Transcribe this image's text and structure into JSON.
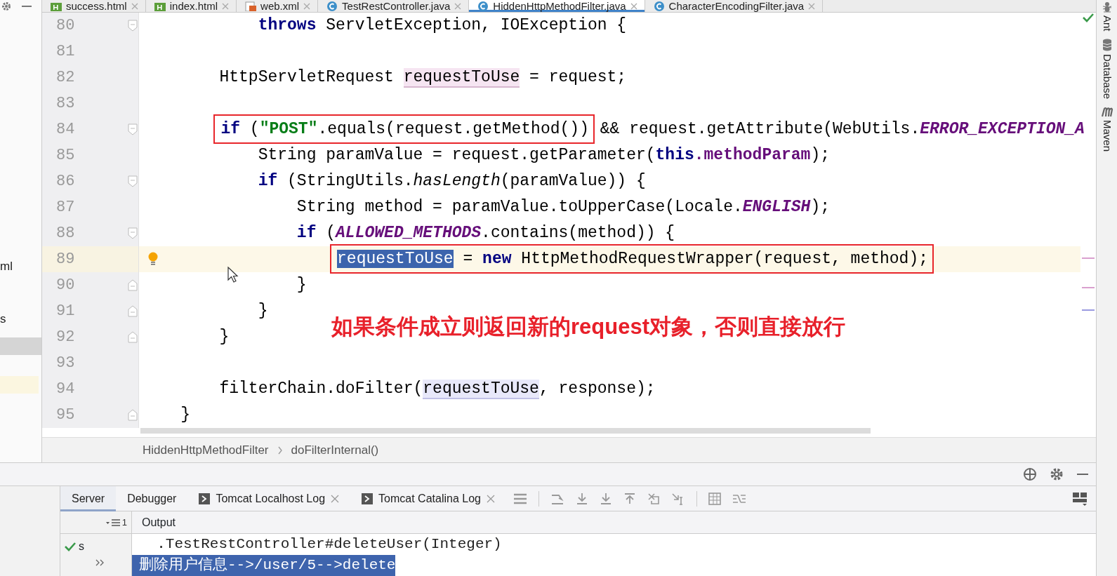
{
  "editor_tabs": [
    {
      "label": "success.html",
      "kind": "html",
      "selected": false
    },
    {
      "label": "index.html",
      "kind": "html",
      "selected": false
    },
    {
      "label": "web.xml",
      "kind": "xml",
      "selected": false
    },
    {
      "label": "TestRestController.java",
      "kind": "java",
      "selected": false
    },
    {
      "label": "HiddenHttpMethodFilter.java",
      "kind": "java",
      "selected": true
    },
    {
      "label": "CharacterEncodingFilter.java",
      "kind": "java",
      "selected": false
    }
  ],
  "project_panel": {
    "items": [
      "ml",
      "s"
    ]
  },
  "editor": {
    "lines": [
      {
        "number": "80",
        "kind": "fold-start",
        "current": false,
        "bulb": false,
        "segments": [
          {
            "boxed": false,
            "tokens": [
              {
                "text": "            throws",
                "kind": "keyword"
              },
              {
                "text": " ServletException, IOException {",
                "kind": "plain"
              }
            ]
          }
        ]
      },
      {
        "number": "81",
        "kind": "plain",
        "current": false,
        "bulb": false
      },
      {
        "number": "82",
        "kind": "plain",
        "current": false,
        "bulb": false,
        "segments": [
          {
            "boxed": false,
            "tokens": [
              {
                "text": "        HttpServletRequest ",
                "kind": "plain"
              },
              {
                "text": "requestToUse",
                "kind": "write-usage"
              },
              {
                "text": " = request;",
                "kind": "plain"
              }
            ]
          }
        ]
      },
      {
        "number": "83",
        "kind": "plain",
        "current": false,
        "bulb": false
      },
      {
        "number": "84",
        "kind": "fold-start",
        "current": false,
        "bulb": false,
        "segments": [
          {
            "boxed": true,
            "tokens": [
              {
                "text": "        if",
                "kind": "keyword"
              },
              {
                "text": " (",
                "kind": "plain"
              },
              {
                "text": "\"POST\"",
                "kind": "string"
              },
              {
                "text": ".equals(request.getMethod())",
                "kind": "plain"
              }
            ]
          },
          {
            "boxed": false,
            "tokens": [
              {
                "text": " && request.getAttribute(WebUtils.",
                "kind": "plain"
              },
              {
                "text": "ERROR_EXCEPTION_A",
                "kind": "constant"
              }
            ]
          }
        ]
      },
      {
        "number": "85",
        "kind": "plain",
        "current": false,
        "bulb": false,
        "segments": [
          {
            "boxed": false,
            "tokens": [
              {
                "text": "            String paramValue = request.getParameter(",
                "kind": "plain"
              },
              {
                "text": "this",
                "kind": "keyword"
              },
              {
                "text": ".methodParam",
                "kind": "field"
              },
              {
                "text": ");",
                "kind": "plain"
              }
            ]
          }
        ]
      },
      {
        "number": "86",
        "kind": "fold-start",
        "current": false,
        "bulb": false,
        "segments": [
          {
            "boxed": false,
            "tokens": [
              {
                "text": "            if",
                "kind": "keyword"
              },
              {
                "text": " (StringUtils.",
                "kind": "plain"
              },
              {
                "text": "hasLength",
                "kind": "static-method"
              },
              {
                "text": "(paramValue)) {",
                "kind": "plain"
              }
            ]
          }
        ]
      },
      {
        "number": "87",
        "kind": "plain",
        "current": false,
        "bulb": false,
        "segments": [
          {
            "boxed": false,
            "tokens": [
              {
                "text": "                String method = paramValue.toUpperCase(Locale.",
                "kind": "plain"
              },
              {
                "text": "ENGLISH",
                "kind": "constant"
              },
              {
                "text": ");",
                "kind": "plain"
              }
            ]
          }
        ]
      },
      {
        "number": "88",
        "kind": "fold-start",
        "current": false,
        "bulb": false,
        "segments": [
          {
            "boxed": false,
            "tokens": [
              {
                "text": "                if",
                "kind": "keyword"
              },
              {
                "text": " (",
                "kind": "plain"
              },
              {
                "text": "ALLOWED_METHODS",
                "kind": "constant"
              },
              {
                "text": ".contains(method)) {",
                "kind": "plain"
              }
            ]
          }
        ]
      },
      {
        "number": "89",
        "kind": "plain",
        "current": true,
        "bulb": true,
        "segments": [
          {
            "boxed": true,
            "tokens": [
              {
                "text": "                    requestToUse",
                "kind": "selected"
              },
              {
                "text": " = ",
                "kind": "plain"
              },
              {
                "text": "new",
                "kind": "keyword"
              },
              {
                "text": " HttpMethodRequestWrapper(request, method);",
                "kind": "plain"
              }
            ]
          }
        ]
      },
      {
        "number": "90",
        "kind": "fold-end",
        "current": false,
        "bulb": false,
        "segments": [
          {
            "boxed": false,
            "tokens": [
              {
                "text": "                }",
                "kind": "plain"
              }
            ]
          }
        ]
      },
      {
        "number": "91",
        "kind": "fold-end",
        "current": false,
        "bulb": false,
        "segments": [
          {
            "boxed": false,
            "tokens": [
              {
                "text": "            }",
                "kind": "plain"
              }
            ]
          }
        ]
      },
      {
        "number": "92",
        "kind": "fold-end",
        "current": false,
        "bulb": false,
        "segments": [
          {
            "boxed": false,
            "tokens": [
              {
                "text": "        }",
                "kind": "plain"
              }
            ]
          }
        ]
      },
      {
        "number": "93",
        "kind": "plain",
        "current": false,
        "bulb": false
      },
      {
        "number": "94",
        "kind": "plain",
        "current": false,
        "bulb": false,
        "segments": [
          {
            "boxed": false,
            "tokens": [
              {
                "text": "        filterChain.doFilter(",
                "kind": "plain"
              },
              {
                "text": "requestToUse",
                "kind": "read-usage"
              },
              {
                "text": ", response);",
                "kind": "plain"
              }
            ]
          }
        ]
      },
      {
        "number": "95",
        "kind": "fold-end",
        "current": false,
        "bulb": false,
        "segments": [
          {
            "boxed": false,
            "tokens": [
              {
                "text": "    }",
                "kind": "plain"
              }
            ]
          }
        ]
      }
    ],
    "annotation": "如果条件成立则返回新的request对象，否则直接放行",
    "breadcrumb": [
      "HiddenHttpMethodFilter",
      "doFilterInternal()"
    ]
  },
  "right_toolbar": [
    {
      "label": "Ant",
      "kind": "ant"
    },
    {
      "label": "Database",
      "kind": "database"
    },
    {
      "label": "Maven",
      "kind": "maven"
    }
  ],
  "bottom_panel": {
    "tabs": [
      {
        "label": "Server",
        "selected": true,
        "kind": "plain"
      },
      {
        "label": "Debugger",
        "selected": false,
        "kind": "plain"
      },
      {
        "label": "Tomcat Localhost Log",
        "selected": false,
        "kind": "log"
      },
      {
        "label": "Tomcat Catalina Log",
        "selected": false,
        "kind": "log"
      }
    ],
    "tree_count": "1",
    "status_text": "s",
    "output_header": "Output",
    "output_lines": [
      {
        "text": "  .TestRestController#deleteUser(Integer)",
        "selected": false
      },
      {
        "text": "删除用户信息-->/user/5-->delete",
        "selected": true
      }
    ]
  }
}
